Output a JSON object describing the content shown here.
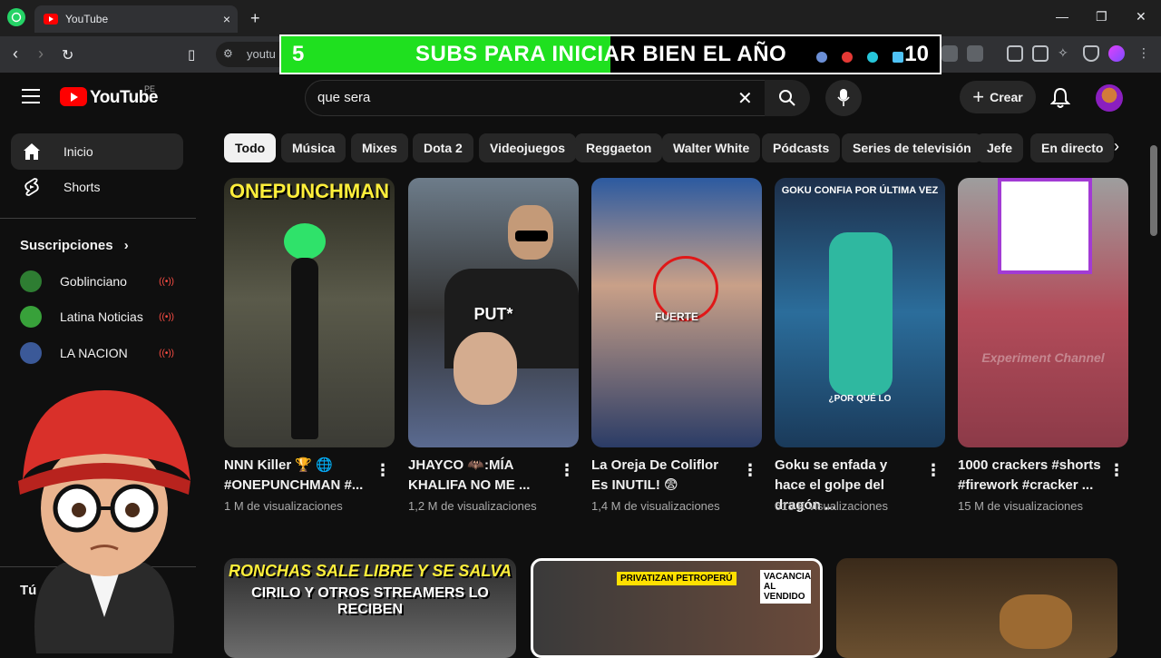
{
  "browser": {
    "tab_title": "YouTube",
    "tab_close": "×",
    "new_tab": "+",
    "url_fragment": "youtu",
    "window_controls": [
      "—",
      "❐",
      "✕"
    ]
  },
  "overlay": {
    "count": "5",
    "message": "SUBS PARA INICIAR BIEN EL AÑO",
    "goal": "10",
    "progress_fraction": 0.5
  },
  "header": {
    "logo_text": "YouTube",
    "country": "PE",
    "search_value": "que sera",
    "create_label": "Crear",
    "create_plus": "+"
  },
  "sidebar": {
    "items": [
      {
        "label": "Inicio",
        "icon": "home-icon"
      },
      {
        "label": "Shorts",
        "icon": "shorts-icon"
      }
    ],
    "subscriptions_heading": "Suscripciones",
    "subscriptions_chevron": "›",
    "subscriptions": [
      {
        "name": "Goblinciano",
        "color": "#2e7d32",
        "live": true
      },
      {
        "name": "Latina Noticias",
        "color": "#38a13a",
        "live": true
      },
      {
        "name": "LA NACION",
        "color": "#3b5998",
        "live": true
      }
    ],
    "you_label": "Tú",
    "live_marker": "((•))"
  },
  "chips": [
    "Todo",
    "Música",
    "Mixes",
    "Dota 2",
    "Videojuegos",
    "Reggaeton",
    "Walter White",
    "Pódcasts",
    "Series de televisión",
    "Jefe",
    "En directo"
  ],
  "chip_next": "›",
  "shorts": [
    {
      "title": "NNN Killer 🏆 🌐 #ONEPUNCHMAN #...",
      "views": "1 M de visualizaciones",
      "overlay_text": "ONEPUNCHMAN"
    },
    {
      "title": "JHAYCO 🦇:MÍA KHALIFA NO ME ...",
      "views": "1,2 M de visualizaciones",
      "overlay_text": "PUT*"
    },
    {
      "title": "La Oreja De Coliflor Es INUTIL! 😨",
      "views": "1,4 M de visualizaciones",
      "overlay_text": "FUERTE"
    },
    {
      "title": "Goku se enfada y hace el golpe del dragón ...",
      "views": "613 K visualizaciones",
      "overlay_text": "GOKU CONFIA POR ÚLTIMA VEZ",
      "overlay_text2": "¿POR QUÉ LO"
    },
    {
      "title": "1000 crackers #shorts #firework #cracker ...",
      "views": "15 M de visualizaciones",
      "overlay_text": "Experiment Channel"
    }
  ],
  "more_glyph": "⋮",
  "row2": [
    {
      "overlay_line1": "RONCHAS SALE LIBRE Y SE SALVA",
      "overlay_line2": "CIRILO Y OTROS STREAMERS LO RECIBEN"
    },
    {
      "overlay_line1": "PRIVATIZAN PETROPERÚ",
      "overlay_line2": "VACANCIA AL VENDIDO"
    },
    {
      "overlay_line1": "",
      "overlay_line2": ""
    }
  ]
}
